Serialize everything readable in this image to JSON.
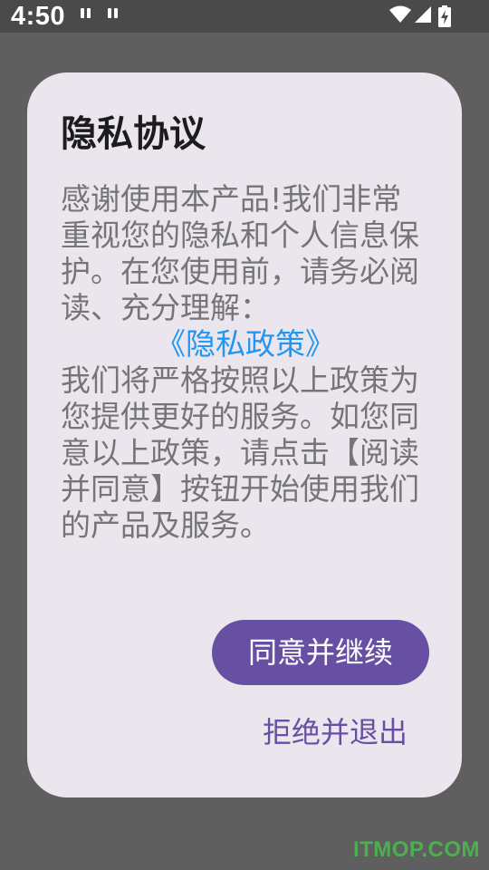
{
  "status_bar": {
    "time": "4:50",
    "icons": [
      "notification-icon",
      "notification-icon",
      "wifi-icon",
      "cellular-signal-icon",
      "battery-charging-icon"
    ]
  },
  "dialog": {
    "title": "隐私协议",
    "body_intro": "感谢使用本产品!我们非常重视您的隐私和个人信息保护。在您使用前，请务必阅读、充分理解：",
    "policy_link": "《隐私政策》",
    "body_outro": "我们将严格按照以上政策为您提供更好的服务。如您同意以上政策，请点击【阅读并同意】按钮开始使用我们的产品及服务。",
    "agree_label": "同意并继续",
    "refuse_label": "拒绝并退出"
  },
  "watermark": "ITMOP.COM",
  "colors": {
    "accent": "#6750a4",
    "link": "#2196f3",
    "dialog_bg": "#ebe6ee",
    "scrim": "#5f5f5f",
    "watermark": "#4caf50"
  }
}
